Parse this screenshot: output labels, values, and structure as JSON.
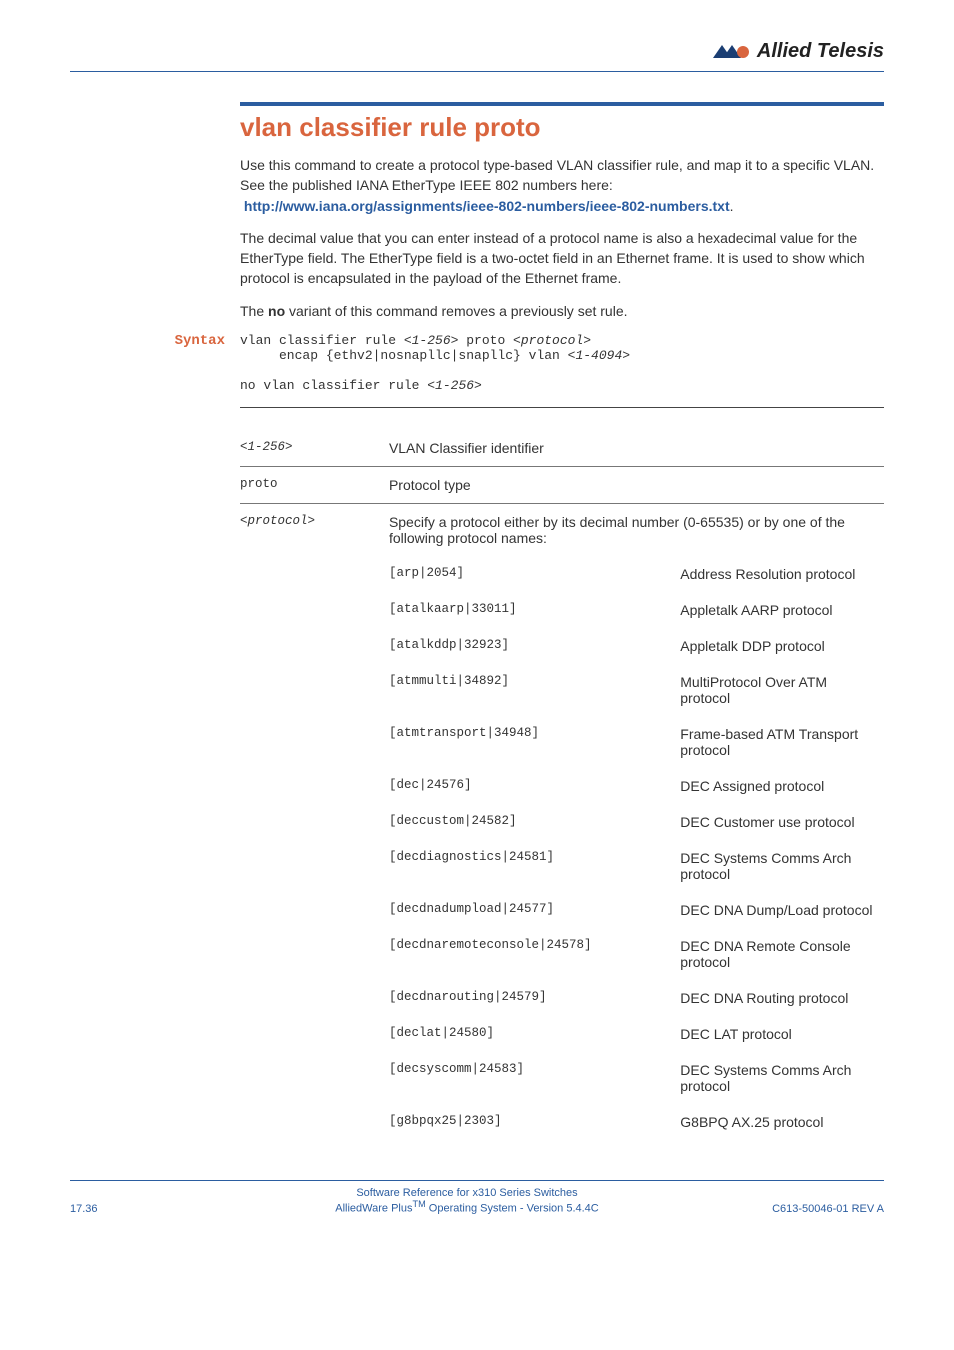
{
  "logo_text": "Allied Telesis",
  "title": "vlan classifier rule proto",
  "intro_para": "Use this command to create a protocol type-based VLAN classifier rule, and map it to a specific VLAN. See the published IANA EtherType IEEE 802 numbers here:",
  "intro_link": "http://www.iana.org/assignments/ieee-802-numbers/ieee-802-numbers.txt",
  "para2": "The decimal value that you can enter instead of a protocol name is also a hexadecimal value for the EtherType field. The EtherType field is a two-octet field in an Ethernet frame. It is used to show which protocol is encapsulated in the payload of the Ethernet frame.",
  "para3_prefix": "The ",
  "para3_bold": "no",
  "para3_suffix": " variant of this command removes a previously set rule.",
  "syntax_label": "Syntax",
  "syntax_line1a": "vlan classifier rule ",
  "syntax_line1b": "<1-256>",
  "syntax_line1c": " proto ",
  "syntax_line1d": "<protocol>",
  "syntax_line2a": "     encap {ethv2|nosnapllc|snapllc} vlan ",
  "syntax_line2b": "<1-4094>",
  "syntax_line3a": "no vlan classifier rule ",
  "syntax_line3b": "<1-256>",
  "params": {
    "p1_name": "<1-256>",
    "p1_desc": "VLAN Classifier identifier",
    "p2_name": "proto",
    "p2_desc": "Protocol type",
    "p3_name": "<protocol>",
    "p3_desc": "Specify a protocol either by its decimal number (0-65535) or by one of the following protocol names:"
  },
  "protocols": [
    {
      "code": "[arp|2054]",
      "desc": "Address Resolution protocol"
    },
    {
      "code": "[atalkaarp|33011]",
      "desc": "Appletalk AARP protocol"
    },
    {
      "code": "[atalkddp|32923]",
      "desc": "Appletalk DDP protocol"
    },
    {
      "code": "[atmmulti|34892]",
      "desc": "MultiProtocol Over ATM protocol"
    },
    {
      "code": "[atmtransport|34948]",
      "desc": "Frame-based ATM Transport protocol"
    },
    {
      "code": "[dec|24576]",
      "desc": "DEC Assigned protocol"
    },
    {
      "code": "[deccustom|24582]",
      "desc": "DEC Customer use protocol"
    },
    {
      "code": "[decdiagnostics|24581]",
      "desc": "DEC Systems Comms Arch protocol"
    },
    {
      "code": "[decdnadumpload|24577]",
      "desc": "DEC DNA Dump/Load protocol"
    },
    {
      "code": "[decdnaremoteconsole|24578]",
      "desc": "DEC DNA Remote Console protocol"
    },
    {
      "code": "[decdnarouting|24579]",
      "desc": "DEC DNA Routing protocol"
    },
    {
      "code": "[declat|24580]",
      "desc": "DEC LAT protocol"
    },
    {
      "code": "[decsyscomm|24583]",
      "desc": "DEC Systems Comms Arch protocol"
    },
    {
      "code": "[g8bpqx25|2303]",
      "desc": "G8BPQ AX.25 protocol"
    }
  ],
  "footer": {
    "left": "17.36",
    "center1": "Software Reference for x310 Series Switches",
    "center2a": "AlliedWare Plus",
    "center2b": "TM",
    "center2c": " Operating System  - Version 5.4.4C",
    "right": "C613-50046-01 REV A"
  }
}
